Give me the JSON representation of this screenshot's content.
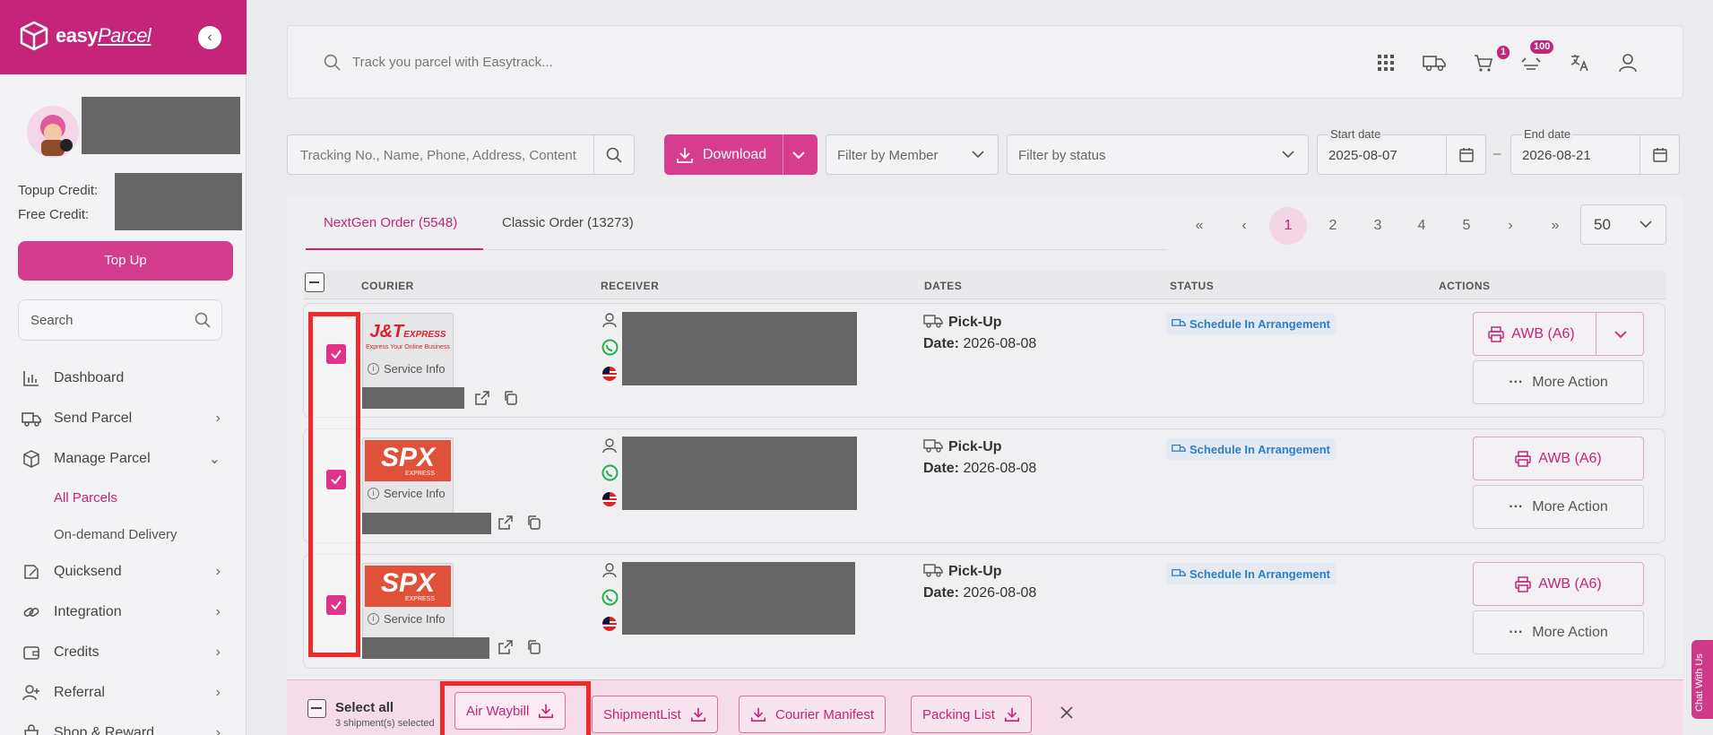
{
  "brand": {
    "name": "easy",
    "name_italic": "Parcel"
  },
  "sidebar": {
    "topup_credit_label": "Topup Credit:",
    "free_credit_label": "Free Credit:",
    "topup_button": "Top Up",
    "search_placeholder": "Search",
    "items": [
      {
        "label": "Dashboard",
        "icon": "chart-icon"
      },
      {
        "label": "Send Parcel",
        "icon": "truck-icon"
      },
      {
        "label": "Manage Parcel",
        "icon": "box-icon"
      },
      {
        "label": "Quicksend",
        "icon": "quicksend-icon"
      },
      {
        "label": "Integration",
        "icon": "link-icon"
      },
      {
        "label": "Credits",
        "icon": "wallet-icon"
      },
      {
        "label": "Referral",
        "icon": "referral-icon"
      },
      {
        "label": "Shop & Reward",
        "icon": "shop-icon"
      }
    ],
    "sub_items": [
      {
        "label": "All Parcels"
      },
      {
        "label": "On-demand Delivery"
      }
    ]
  },
  "topbar": {
    "search_placeholder": "Track you parcel with Easytrack...",
    "cart_badge": "1",
    "notification_badge": "100"
  },
  "filters": {
    "search_placeholder": "Tracking No., Name, Phone, Address, Content",
    "download_label": "Download",
    "member_placeholder": "Filter by Member",
    "status_placeholder": "Filter by status",
    "start_date_label": "Start date",
    "start_date": "2025-08-07",
    "end_date_label": "End date",
    "end_date": "2026-08-21",
    "date_separator": "–"
  },
  "tabs": [
    {
      "label": "NextGen Order (5548)"
    },
    {
      "label": "Classic Order (13273)"
    }
  ],
  "pagination": {
    "pages": [
      "1",
      "2",
      "3",
      "4",
      "5"
    ],
    "current": "1",
    "per_page": "50"
  },
  "table": {
    "columns": [
      "COURIER",
      "RECEIVER",
      "DATES",
      "STATUS",
      "ACTIONS"
    ],
    "rows": [
      {
        "courier": "J&T EXPRESS",
        "courier_tagline": "Express Your Online Business",
        "service_info": "Service Info",
        "date_type": "Pick-Up",
        "date_label": "Date:",
        "date": "2026-08-08",
        "status": "Schedule In Arrangement",
        "awb": "AWB (A6)",
        "more": "More Action"
      },
      {
        "courier": "SPX",
        "courier_tagline": "EXPRESS",
        "service_info": "Service Info",
        "date_type": "Pick-Up",
        "date_label": "Date:",
        "date": "2026-08-08",
        "status": "Schedule In Arrangement",
        "awb": "AWB (A6)",
        "more": "More Action"
      },
      {
        "courier": "SPX",
        "courier_tagline": "EXPRESS",
        "service_info": "Service Info",
        "date_type": "Pick-Up",
        "date_label": "Date:",
        "date": "2026-08-08",
        "status": "Schedule In Arrangement",
        "awb": "AWB (A6)",
        "more": "More Action"
      }
    ]
  },
  "bulk_bar": {
    "select_all": "Select all",
    "selected_count": "3 shipment(s) selected",
    "buttons": [
      "Air Waybill",
      "ShipmentList",
      "Courier Manifest",
      "Packing List"
    ]
  },
  "chat": {
    "label": "Chat With Us"
  },
  "colors": {
    "brand": "#c4247a",
    "accent": "#d63d8f",
    "status_blue": "#2f7ec1",
    "highlight": "#ee2b2b"
  }
}
